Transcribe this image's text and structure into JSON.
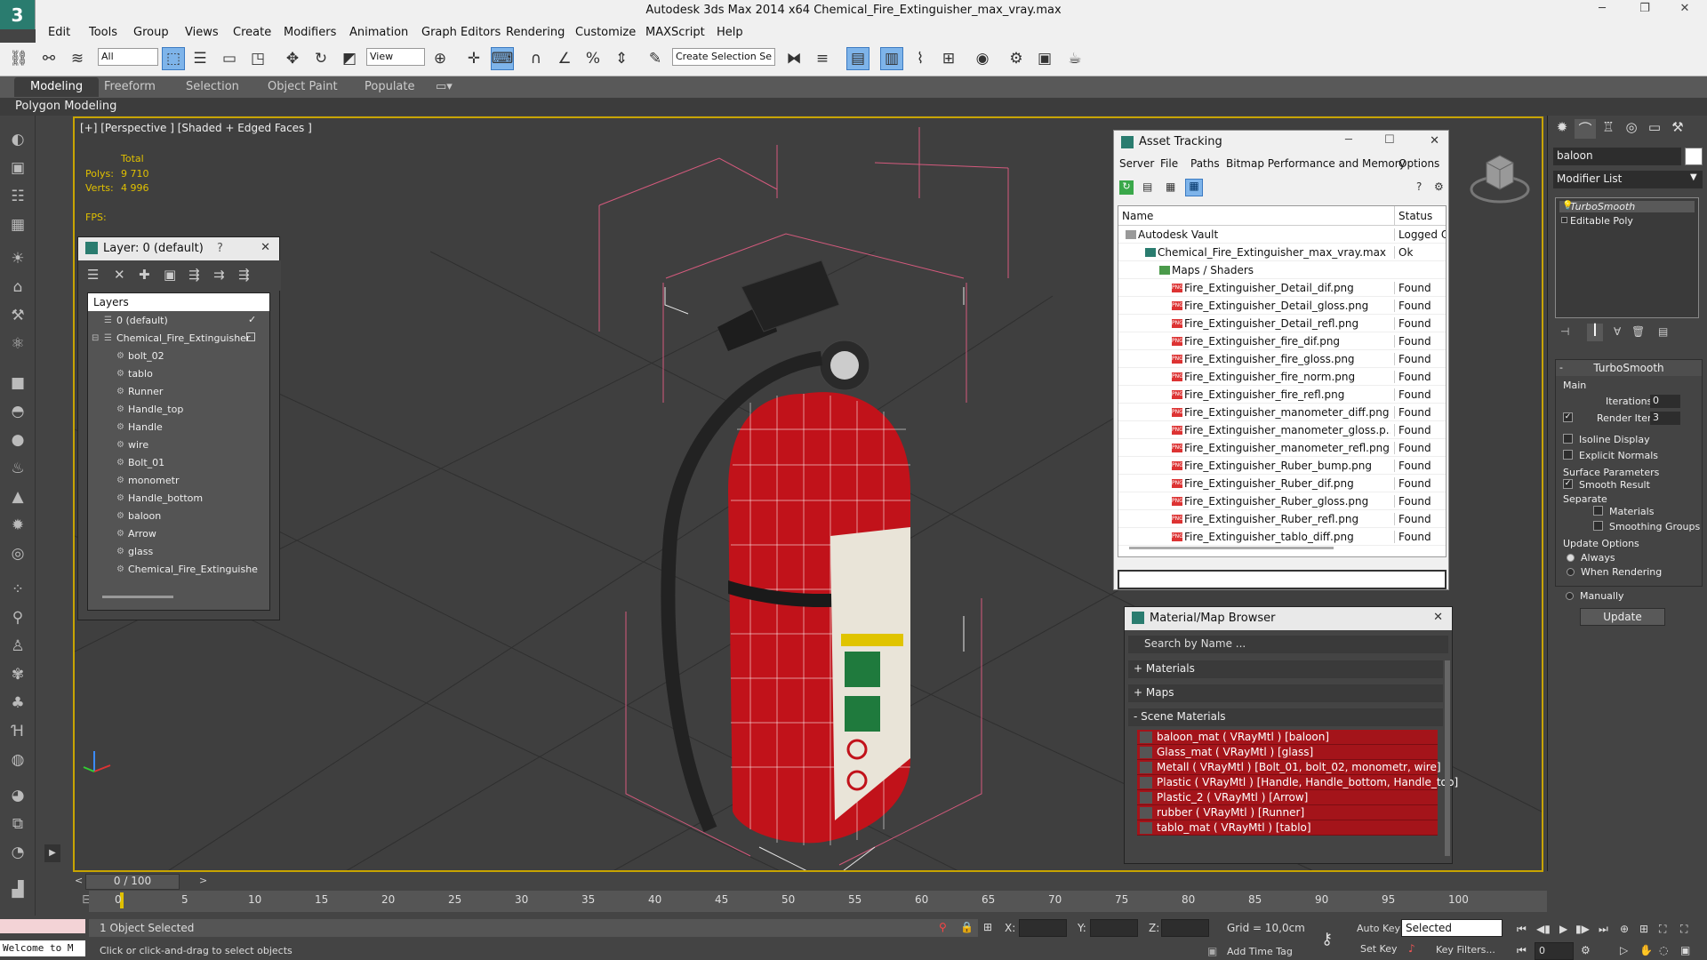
{
  "app": {
    "title": "Autodesk 3ds Max  2014 x64     Chemical_Fire_Extinguisher_max_vray.max",
    "logo": "3"
  },
  "menu": [
    "Edit",
    "Tools",
    "Group",
    "Views",
    "Create",
    "Modifiers",
    "Animation",
    "Graph Editors",
    "Rendering",
    "Customize",
    "MAXScript",
    "Help"
  ],
  "toolbar": {
    "filter": "All",
    "refcoord": "View",
    "selection_set": "Create Selection Se"
  },
  "ribbon": {
    "tabs": [
      "Modeling",
      "Freeform",
      "Selection",
      "Object Paint",
      "Populate"
    ],
    "subtitle": "Polygon Modeling"
  },
  "viewport": {
    "label": "[+] [Perspective ] [Shaded + Edged Faces ]",
    "stats": {
      "total_label": "Total",
      "polys_label": "Polys:",
      "polys": "9 710",
      "verts_label": "Verts:",
      "verts": "4 996",
      "fps_label": "FPS:"
    }
  },
  "layer_panel": {
    "title": "Layer: 0 (default)",
    "help": "?",
    "header": "Layers",
    "rows": [
      "0 (default)",
      "Chemical_Fire_Extinguisher",
      "bolt_02",
      "tablo",
      "Runner",
      "Handle_top",
      "Handle",
      "wire",
      "Bolt_01",
      "monometr",
      "Handle_bottom",
      "baloon",
      "Arrow",
      "glass",
      "Chemical_Fire_Extinguishe"
    ]
  },
  "asset_panel": {
    "title": "Asset Tracking",
    "menu": [
      "Server",
      "File",
      "Paths",
      "Bitmap Performance and Memory",
      "Options"
    ],
    "col_name": "Name",
    "col_status": "Status",
    "rows": [
      {
        "name": "Autodesk Vault",
        "status": "Logged Out ..."
      },
      {
        "name": "Chemical_Fire_Extinguisher_max_vray.max",
        "status": "Ok"
      },
      {
        "name": "Maps / Shaders",
        "status": ""
      },
      {
        "name": "Fire_Extinguisher_Detail_dif.png",
        "status": "Found"
      },
      {
        "name": "Fire_Extinguisher_Detail_gloss.png",
        "status": "Found"
      },
      {
        "name": "Fire_Extinguisher_Detail_refl.png",
        "status": "Found"
      },
      {
        "name": "Fire_Extinguisher_fire_dif.png",
        "status": "Found"
      },
      {
        "name": "Fire_Extinguisher_fire_gloss.png",
        "status": "Found"
      },
      {
        "name": "Fire_Extinguisher_fire_norm.png",
        "status": "Found"
      },
      {
        "name": "Fire_Extinguisher_fire_refl.png",
        "status": "Found"
      },
      {
        "name": "Fire_Extinguisher_manometer_diff.png",
        "status": "Found"
      },
      {
        "name": "Fire_Extinguisher_manometer_gloss.p...",
        "status": "Found"
      },
      {
        "name": "Fire_Extinguisher_manometer_refl.png",
        "status": "Found"
      },
      {
        "name": "Fire_Extinguisher_Ruber_bump.png",
        "status": "Found"
      },
      {
        "name": "Fire_Extinguisher_Ruber_dif.png",
        "status": "Found"
      },
      {
        "name": "Fire_Extinguisher_Ruber_gloss.png",
        "status": "Found"
      },
      {
        "name": "Fire_Extinguisher_Ruber_refl.png",
        "status": "Found"
      },
      {
        "name": "Fire_Extinguisher_tablo_diff.png",
        "status": "Found"
      }
    ]
  },
  "mat_panel": {
    "title": "Material/Map Browser",
    "search_placeholder": "Search by Name ...",
    "sections": [
      "+ Materials",
      "+ Maps",
      "- Scene Materials"
    ],
    "materials": [
      "baloon_mat  ( VRayMtl ) [baloon]",
      "Glass_mat  ( VRayMtl ) [glass]",
      "Metall  ( VRayMtl ) [Bolt_01, bolt_02, monometr, wire]",
      "Plastic  ( VRayMtl ) [Handle, Handle_bottom, Handle_top]",
      "Plastic_2  ( VRayMtl ) [Arrow]",
      "rubber  ( VRayMtl ) [Runner]",
      "tablo_mat  ( VRayMtl ) [tablo]"
    ]
  },
  "command_panel": {
    "object_name": "baloon",
    "modifier_list": "Modifier List",
    "stack": [
      "TurboSmooth",
      "Editable Poly"
    ],
    "turbosmooth": {
      "title": "TurboSmooth",
      "main": "Main",
      "iterations_label": "Iterations:",
      "iterations": "0",
      "render_iters_label": "Render Iters:",
      "render_iters": "3",
      "isoline": "Isoline Display",
      "explicit": "Explicit Normals",
      "surface": "Surface Parameters",
      "smooth_result": "Smooth Result",
      "separate": "Separate",
      "materials": "Materials",
      "smoothing_groups": "Smoothing Groups",
      "update_options": "Update Options",
      "always": "Always",
      "when_rendering": "When Rendering",
      "manually": "Manually",
      "update": "Update"
    }
  },
  "timeline": {
    "frame": "0 / 100",
    "ticks": [
      "0",
      "5",
      "10",
      "15",
      "20",
      "25",
      "30",
      "35",
      "40",
      "45",
      "50",
      "55",
      "60",
      "65",
      "70",
      "75",
      "80",
      "85",
      "90",
      "95",
      "100"
    ]
  },
  "status": {
    "maxscript": "",
    "welcome": "Welcome to M",
    "selected": "1 Object Selected",
    "prompt": "Click or click-and-drag to select objects",
    "x_label": "X:",
    "y_label": "Y:",
    "z_label": "Z:",
    "grid": "Grid = 10,0cm",
    "add_time_tag": "Add Time Tag",
    "auto_key": "Auto Key",
    "set_key": "Set Key",
    "key_mode": "Selected",
    "key_filters": "Key Filters...",
    "frame_field": "0"
  },
  "colors": {
    "accent": "#c8a400",
    "material_red": "#a4141a",
    "extinguisher_red": "#c1121a"
  }
}
